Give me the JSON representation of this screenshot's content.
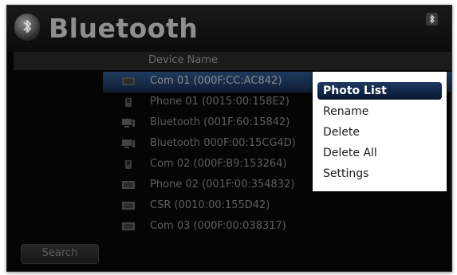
{
  "window": {
    "title": "Bluetooth"
  },
  "list": {
    "column_header": "Device Name",
    "devices": [
      {
        "label": "Com 01 (000F:CC:AC842)",
        "icon": "monitor-icon",
        "selected": true
      },
      {
        "label": "Phone 01 (0015:00:158E2)",
        "icon": "phone-icon"
      },
      {
        "label": "Bluetooth (001F:60:15842)",
        "icon": "computer-icon"
      },
      {
        "label": "Bluetooth 000F:00:15CG4D)",
        "icon": "computer-icon"
      },
      {
        "label": "Com 02 (000F:B9:153264)",
        "icon": "phone-icon"
      },
      {
        "label": "Phone 02 (001F:00:354832)",
        "icon": "monitor-icon"
      },
      {
        "label": "CSR (0010:00:155D42)",
        "icon": "monitor-icon"
      },
      {
        "label": "Com 03 (000F:00:038317)",
        "icon": "monitor-icon"
      }
    ]
  },
  "search_button": {
    "label": "Search"
  },
  "context_menu": {
    "items": [
      {
        "label": "Photo List",
        "active": true
      },
      {
        "label": "Rename"
      },
      {
        "label": "Delete"
      },
      {
        "label": "Delete All"
      },
      {
        "label": "Settings"
      }
    ]
  },
  "colors": {
    "background": "#050505",
    "selection": "#1e3a5e",
    "menu_highlight": "#1f3a64"
  }
}
